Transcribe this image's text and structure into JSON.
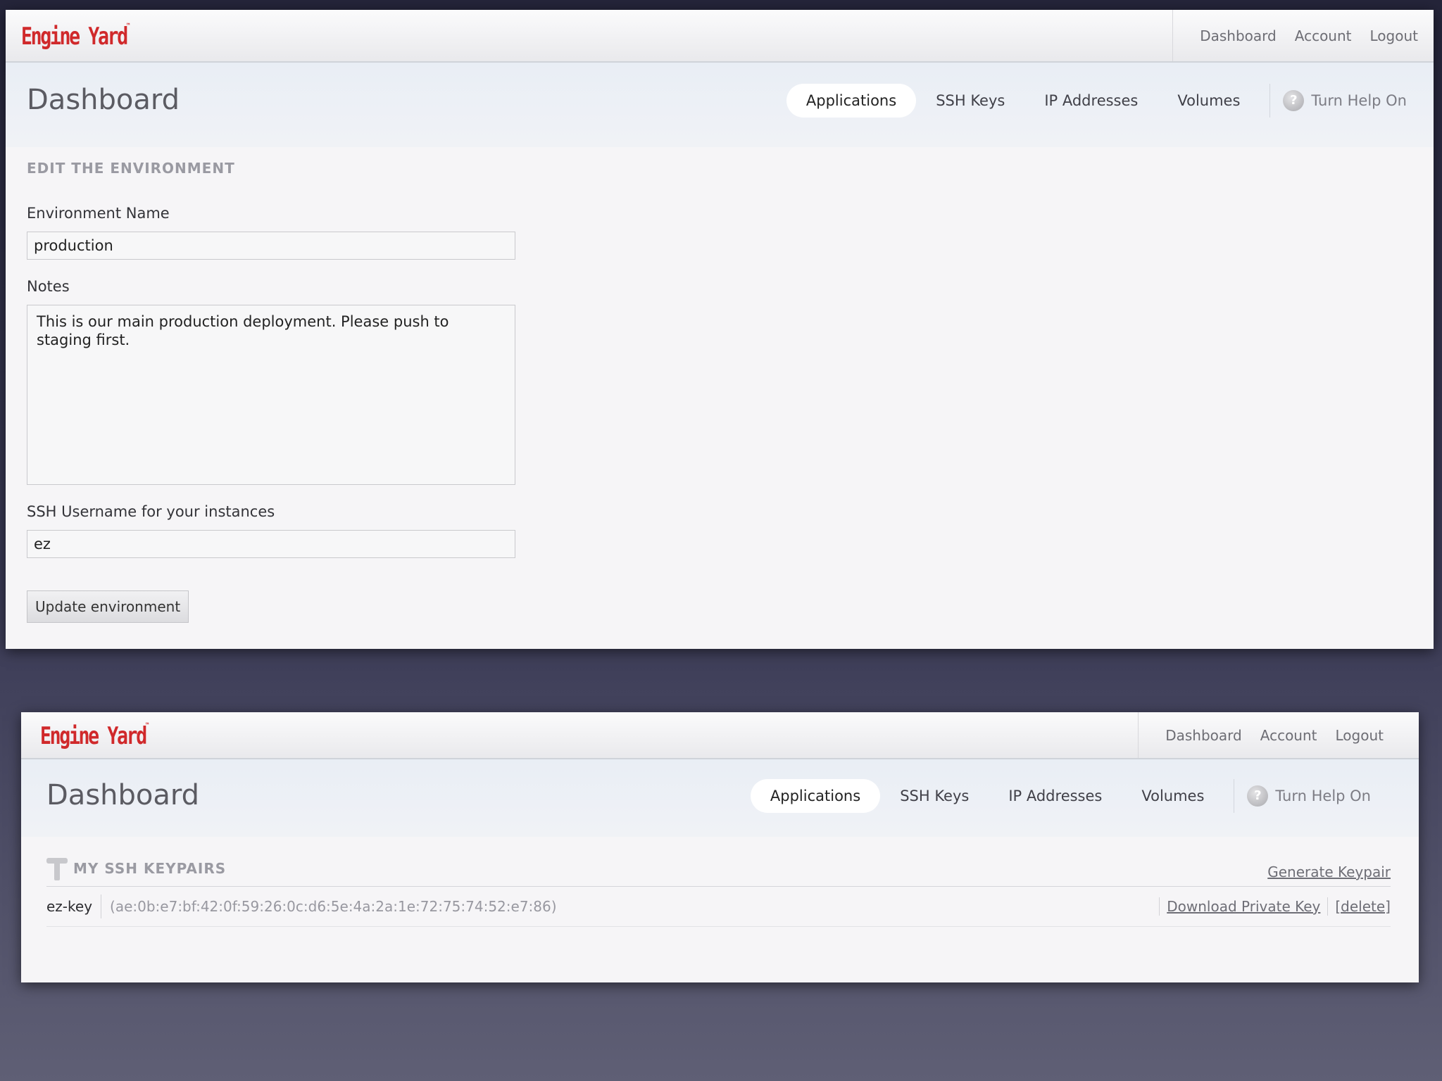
{
  "brand": {
    "logo_text": "Engine Yard",
    "logo_tm": "™"
  },
  "top_nav": [
    "Dashboard",
    "Account",
    "Logout"
  ],
  "page_title": "Dashboard",
  "tabs": [
    {
      "label": "Applications",
      "active": true
    },
    {
      "label": "SSH Keys",
      "active": false
    },
    {
      "label": "IP Addresses",
      "active": false
    },
    {
      "label": "Volumes",
      "active": false
    }
  ],
  "help": {
    "label": "Turn Help On",
    "icon": "question-circle-icon"
  },
  "edit_form": {
    "heading": "EDIT THE ENVIRONMENT",
    "env_name_label": "Environment Name",
    "env_name_value": "production",
    "notes_label": "Notes",
    "notes_value": "This is our main production deployment. Please push to staging first.",
    "ssh_username_label": "SSH Username for your instances",
    "ssh_username_value": "ez",
    "submit_label": "Update environment"
  },
  "ssh_keypairs": {
    "heading": "MY SSH KEYPAIRS",
    "heading_icon": "key-icon",
    "generate_label": "Generate Keypair",
    "items": [
      {
        "name": "ez-key",
        "fingerprint": "(ae:0b:e7:bf:42:0f:59:26:0c:d6:5e:4a:2a:1e:72:75:74:52:e7:86)",
        "download_label": "Download Private Key",
        "delete_label": "[delete]"
      }
    ]
  },
  "colors": {
    "logo": "#d0292b",
    "page_bg": "#f6f5f7",
    "header_band": "#e9eef5"
  }
}
